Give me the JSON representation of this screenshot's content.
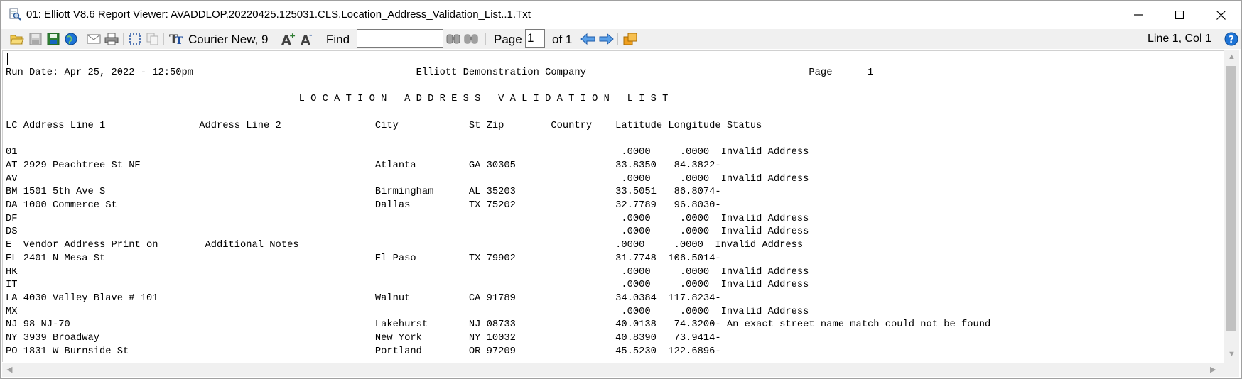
{
  "window": {
    "title": "01: Elliott V8.6 Report Viewer: AVADDLOP.20220425.125031.CLS.Location_Address_Validation_List..1.Txt"
  },
  "toolbar": {
    "font_label": "Courier New, 9",
    "find_label": "Find",
    "find_value": "",
    "page_label": "Page",
    "page_value": "1",
    "of_label": "of 1",
    "position": "Line 1, Col 1"
  },
  "icons": [
    "open-folder-icon",
    "save-icon",
    "save-as-icon",
    "globe-icon",
    "mail-icon",
    "print-icon",
    "select-icon",
    "copy-icon",
    "font-icon",
    "font-larger-icon",
    "font-smaller-icon",
    "find-next-icon",
    "find-previous-icon",
    "previous-page-icon",
    "next-page-icon",
    "export-icon",
    "help-icon"
  ],
  "colors": {
    "accent": "#1e74d6",
    "orange": "#f0a020"
  },
  "report": {
    "lines": [
      "Run Date: Apr 25, 2022 - 12:50pm                                      Elliott Demonstration Company                                      Page      1",
      "",
      "                                                  L O C A T I O N   A D D R E S S   V A L I D A T I O N   L I S T",
      "",
      "LC Address Line 1                Address Line 2                City            St Zip        Country    Latitude Longitude Status",
      "",
      "01                                                                                                       .0000     .0000  Invalid Address",
      "AT 2929 Peachtree St NE                                        Atlanta         GA 30305                 33.8350   84.3822-",
      "AV                                                                                                       .0000     .0000  Invalid Address",
      "BM 1501 5th Ave S                                              Birmingham      AL 35203                 33.5051   86.8074-",
      "DA 1000 Commerce St                                            Dallas          TX 75202                 32.7789   96.8030-",
      "DF                                                                                                       .0000     .0000  Invalid Address",
      "DS                                                                                                       .0000     .0000  Invalid Address",
      "E  Vendor Address Print on        Additional Notes                                                      .0000     .0000  Invalid Address",
      "EL 2401 N Mesa St                                              El Paso         TX 79902                 31.7748  106.5014-",
      "HK                                                                                                       .0000     .0000  Invalid Address",
      "IT                                                                                                       .0000     .0000  Invalid Address",
      "LA 4030 Valley Blave # 101                                     Walnut          CA 91789                 34.0384  117.8234-",
      "MX                                                                                                       .0000     .0000  Invalid Address",
      "NJ 98 NJ-70                                                    Lakehurst       NJ 08733                 40.0138   74.3200- An exact street name match could not be found",
      "NY 3939 Broadway                                               New York        NY 10032                 40.8390   73.9414-",
      "PO 1831 W Burnside St                                          Portland        OR 97209                 45.5230  122.6896-"
    ]
  }
}
